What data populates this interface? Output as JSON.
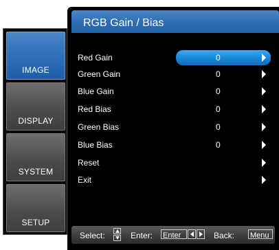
{
  "menu": {
    "title": "RGB Gain / Bias",
    "tabs": [
      {
        "label": "IMAGE",
        "active": true
      },
      {
        "label": "DISPLAY",
        "active": false
      },
      {
        "label": "SYSTEM",
        "active": false
      },
      {
        "label": "SETUP",
        "active": false
      }
    ],
    "items": [
      {
        "label": "Red Gain",
        "value": "0",
        "selected": true
      },
      {
        "label": "Green Gain",
        "value": "0"
      },
      {
        "label": "Blue Gain",
        "value": "0"
      },
      {
        "label": "Red Bias",
        "value": "0"
      },
      {
        "label": "Green Bias",
        "value": "0"
      },
      {
        "label": "Blue Bias",
        "value": "0"
      },
      {
        "label": "Reset",
        "value": ""
      },
      {
        "label": "Exit",
        "value": ""
      }
    ]
  },
  "footer": {
    "select_label": "Select:",
    "enter_label": "Enter:",
    "enter_key": "Enter",
    "back_label": "Back:",
    "back_key": "Menu"
  },
  "colors": {
    "accent": "#2e6cb3",
    "highlight": "#1684d8",
    "background": "#000000"
  }
}
